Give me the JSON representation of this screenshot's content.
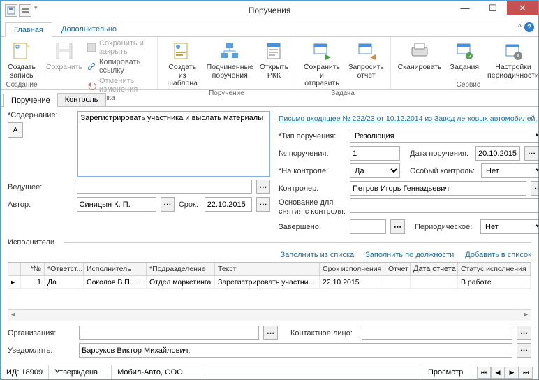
{
  "window": {
    "title": "Поручения"
  },
  "menuTabs": {
    "main": "Главная",
    "extra": "Дополнительно"
  },
  "ribbon": {
    "create": {
      "label": "Создать\nзапись",
      "group": "Создание"
    },
    "card": {
      "save": "Сохранить",
      "saveClose": "Сохранить и закрыть",
      "copyLink": "Копировать ссылку",
      "undo": "Отменить изменения",
      "group": "Карточка"
    },
    "assignment": {
      "fromTemplate": "Создать из\nшаблона",
      "subordinate": "Подчиненные\nпоручения",
      "openRkk": "Открыть\nРКК",
      "group": "Поручение"
    },
    "task": {
      "saveSend": "Сохранить\nи отправить",
      "requestReport": "Запросить\nотчет",
      "group": "Задача"
    },
    "service": {
      "scan": "Сканировать",
      "tasks": "Задания",
      "periodicity": "Настройки\nпериодичности",
      "group": "Сервис"
    }
  },
  "subTabs": {
    "assignment": "Поручение",
    "control": "Контроль"
  },
  "labels": {
    "content": "Содержание:",
    "leading": "Ведущее:",
    "author": "Автор:",
    "deadline": "Срок:",
    "type": "Тип поручения:",
    "number": "№ поручения:",
    "onControl": "На контроле:",
    "controller": "Контролер:",
    "removeBasis": "Основание для\nснятия с контроля:",
    "completed": "Завершено:",
    "assignDate": "Дата поручения:",
    "specialControl": "Особый контроль:",
    "periodic": "Периодическое:",
    "executors": "Исполнители",
    "organization": "Организация:",
    "contact": "Контактное лицо:",
    "notify": "Уведомлять:"
  },
  "values": {
    "content": "Зарегистрировать участника и выслать материалы",
    "leading": "",
    "author": "Синицын К. П.",
    "deadline": "22.10.2015",
    "sourceLink": "Письмо входящее № 222/23 от 10.12.2014 из Завод легковых автомобилей, ...",
    "type": "Резолюция",
    "number": "1",
    "onControl": "Да",
    "controller": "Петров Игорь Геннадьевич",
    "removeBasis": "",
    "completed": "",
    "assignDate": "20.10.2015",
    "specialControl": "Нет",
    "periodic": "Нет",
    "organization": "",
    "contact": "",
    "notify": "Барсуков Виктор Михайлович;"
  },
  "links": {
    "fillFromList": "Заполнить из списка",
    "fillByPosition": "Заполнить по должности",
    "addToList": "Добавить в список"
  },
  "grid": {
    "headers": {
      "no": "*№",
      "resp": "*Ответст...",
      "exec": "Исполнитель",
      "dept": "*Подразделение",
      "text": "Текст",
      "due": "Срок исполнения",
      "rep": "Отчет",
      "repDate": "Дата отчета",
      "status": "Статус исполнения"
    },
    "rows": [
      {
        "no": "1",
        "resp": "Да",
        "exec": "Соколов В.П. (М...",
        "dept": "Отдел маркетинга",
        "text": "Зарегистрировать участника и выслат...",
        "due": "22.10.2015",
        "rep": "",
        "repDate": "",
        "status": "В работе"
      }
    ]
  },
  "status": {
    "id": "ИД: 18909",
    "state": "Утверждена",
    "org": "Мобил-Авто, ООО",
    "mode": "Просмотр"
  }
}
